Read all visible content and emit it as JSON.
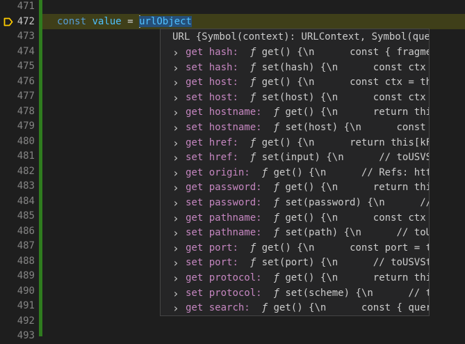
{
  "gutter": {
    "line_numbers": [
      "471",
      "472",
      "473",
      "474",
      "475",
      "476",
      "477",
      "478",
      "479",
      "480",
      "481",
      "482",
      "483",
      "484",
      "485",
      "486",
      "487",
      "488",
      "489",
      "490",
      "491",
      "492",
      "493"
    ],
    "active_line": "472"
  },
  "code": {
    "keyword": "const",
    "identifier": "value",
    "operator": "=",
    "selected_identifier": "urlObject"
  },
  "hover": {
    "header": "URL {Symbol(context): URLContext, Symbol(quer…",
    "rows": [
      {
        "accessor": "get",
        "name": "hash:",
        "sig": "get() {\\n",
        "body": "const { fragment"
      },
      {
        "accessor": "set",
        "name": "hash:",
        "sig": "set(hash) {\\n",
        "body": "const ctx = t"
      },
      {
        "accessor": "get",
        "name": "host:",
        "sig": "get() {\\n",
        "body": "const ctx = this["
      },
      {
        "accessor": "set",
        "name": "host:",
        "sig": "set(host) {\\n",
        "body": "const ctx = t"
      },
      {
        "accessor": "get",
        "name": "hostname:",
        "sig": "get() {\\n",
        "body": "return this[c"
      },
      {
        "accessor": "set",
        "name": "hostname:",
        "sig": "set(host) {\\n",
        "body": "const ctx"
      },
      {
        "accessor": "get",
        "name": "href:",
        "sig": "get() {\\n",
        "body": "return this[kForm"
      },
      {
        "accessor": "set",
        "name": "href:",
        "sig": "set(input) {\\n",
        "body": "// toUSVStri"
      },
      {
        "accessor": "get",
        "name": "origin:",
        "sig": "get() {\\n",
        "body": "// Refs: https:"
      },
      {
        "accessor": "get",
        "name": "password:",
        "sig": "get() {\\n",
        "body": "return this[c"
      },
      {
        "accessor": "set",
        "name": "password:",
        "sig": "set(password) {\\n",
        "body": "// to"
      },
      {
        "accessor": "get",
        "name": "pathname:",
        "sig": "get() {\\n",
        "body": "const ctx = t"
      },
      {
        "accessor": "set",
        "name": "pathname:",
        "sig": "set(path) {\\n",
        "body": "// toUSVS"
      },
      {
        "accessor": "get",
        "name": "port:",
        "sig": "get() {\\n",
        "body": "const port = this"
      },
      {
        "accessor": "set",
        "name": "port:",
        "sig": "set(port) {\\n",
        "body": "// toUSVStrin"
      },
      {
        "accessor": "get",
        "name": "protocol:",
        "sig": "get() {\\n",
        "body": "return this[c"
      },
      {
        "accessor": "set",
        "name": "protocol:",
        "sig": "set(scheme) {\\n",
        "body": "// toUS"
      },
      {
        "accessor": "get",
        "name": "search:",
        "sig": "get() {\\n",
        "body": "const { query }"
      }
    ]
  },
  "icons": {
    "chevron": "chevron-right-icon",
    "breakpoint": "debug-breakpoint-icon",
    "function_symbol": "ƒ"
  },
  "colors": {
    "background": "#1e1e1e",
    "hover_background": "#252526",
    "accent_purple": "#c586c0",
    "keyword_blue": "#569cd6",
    "identifier_cyan": "#4fc1ff",
    "stopped_line": "#4b4b18",
    "gutter_bar": "#2f7c1f"
  }
}
